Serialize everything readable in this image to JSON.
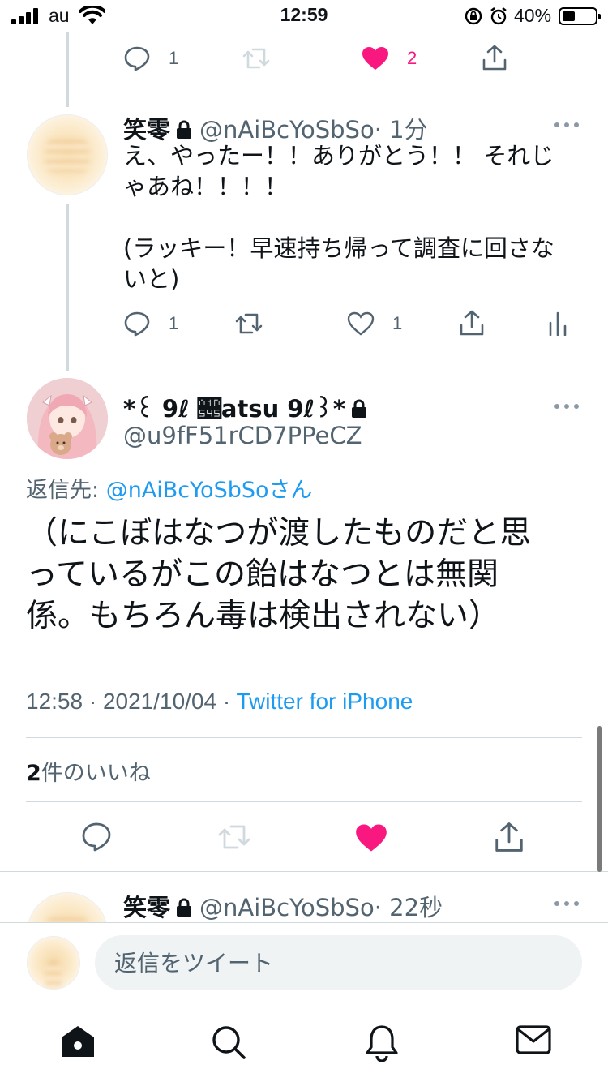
{
  "status_bar": {
    "carrier": "au",
    "time": "12:59",
    "battery_percent": "40%",
    "battery_level": 0.4
  },
  "prev_tweet_actions": {
    "reply_count": "1",
    "like_count": "2"
  },
  "reply_tweet_1": {
    "display_name": "笑零",
    "handle": "@nAiBcYoSbSo",
    "time": "· 1分",
    "text_line_1": "え、やったー！！ありがとう！！ それじ",
    "text_line_2": "ゃあね！！！！",
    "text_line_3": "(ラッキー！早速持ち帰って調査に回さな",
    "text_line_4": "いと)",
    "reply_count": "1",
    "like_count": "1"
  },
  "main_tweet": {
    "display_name": "*꒰ 9ℓ 𝕅atsu 9ℓ꒱*",
    "handle": "@u9fF51rCD7PPeCZ",
    "reply_to_label": "返信先: ",
    "reply_to_handle": "@nAiBcYoSbSoさん",
    "text_line_1": "（にこぼはなつが渡したものだと思",
    "text_line_2": "っているがこの飴はなつとは無関",
    "text_line_3": "係。もちろん毒は検出されない）",
    "timestamp": "12:58 · 2021/10/04 · ",
    "source": "Twitter for iPhone",
    "likes_count": "2",
    "likes_label": "件のいいね"
  },
  "next_tweet": {
    "display_name": "笑零",
    "handle": "@nAiBcYoSbSo",
    "time": "· 22秒"
  },
  "composer": {
    "placeholder": "返信をツイート"
  },
  "colors": {
    "accent": "#1d9bf0",
    "like": "#f91880",
    "muted": "#536471",
    "border": "#cfd9de"
  }
}
